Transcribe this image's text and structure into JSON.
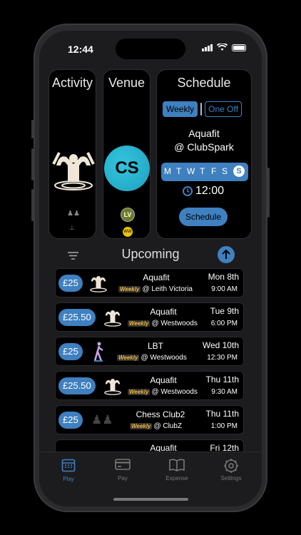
{
  "status": {
    "time": "12:44"
  },
  "activity": {
    "title": "Activity"
  },
  "venue": {
    "title": "Venue",
    "logo_text": "CS",
    "badge_lv": "LV",
    "badge_ww": "WW"
  },
  "schedule": {
    "title": "Schedule",
    "seg_weekly": "Weekly",
    "seg_oneoff": "One Off",
    "activity": "Aquafit",
    "venue": "@ ClubSpark",
    "days": [
      "M",
      "T",
      "W",
      "T",
      "F",
      "S",
      "S"
    ],
    "time": "12:00",
    "button": "Schedule"
  },
  "upcoming": {
    "title": "Upcoming"
  },
  "rows": [
    {
      "price": "£25",
      "name": "Aquafit",
      "tag": "Weekly",
      "place": "@ Leith Victoria",
      "day": "Mon 8th",
      "time": "9:00 AM"
    },
    {
      "price": "£25.50",
      "name": "Aquafit",
      "tag": "Weekly",
      "place": "@ Westwoods",
      "day": "Tue 9th",
      "time": "6:00 PM"
    },
    {
      "price": "£25",
      "name": "LBT",
      "tag": "Weekly",
      "place": "@ Westwoods",
      "day": "Wed 10th",
      "time": "12:30 PM"
    },
    {
      "price": "£25.50",
      "name": "Aquafit",
      "tag": "Weekly",
      "place": "@ Westwoods",
      "day": "Thu 11th",
      "time": "9:30 AM"
    },
    {
      "price": "£25",
      "name": "Chess Club2",
      "tag": "Weekly",
      "place": "@ ClubZ",
      "day": "Thu 11th",
      "time": "1:00 PM"
    },
    {
      "price": "",
      "name": "Aquafit",
      "tag": "",
      "place": "",
      "day": "Fri 12th",
      "time": ""
    }
  ],
  "tabs": {
    "play": "Play",
    "pay": "Pay",
    "expense": "Expense",
    "settings": "Settings"
  },
  "colors": {
    "accent": "#3f80c0",
    "weekly_tag": "#f0b63b",
    "venue_logo": "#2bb8d4"
  }
}
